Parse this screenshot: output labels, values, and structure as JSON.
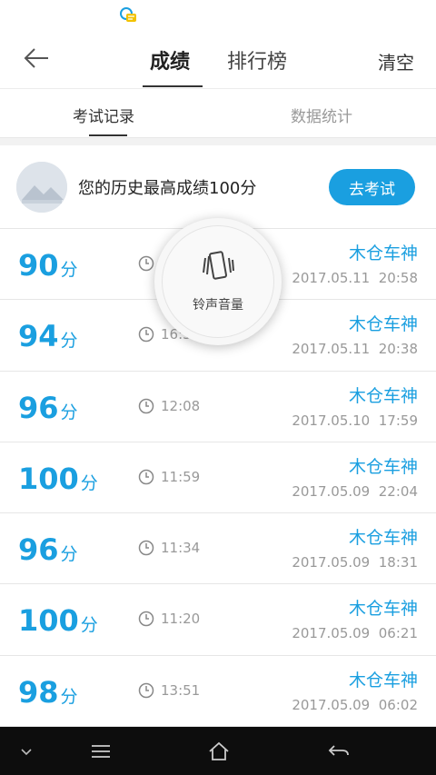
{
  "status_bar": {
    "icon": "chat-notification-icon"
  },
  "header": {
    "back_icon": "arrow-left-icon",
    "tabs": [
      {
        "label": "成绩",
        "active": true
      },
      {
        "label": "排行榜",
        "active": false
      }
    ],
    "clear_label": "清空"
  },
  "subtabs": [
    {
      "label": "考试记录",
      "active": true
    },
    {
      "label": "数据统计",
      "active": false
    }
  ],
  "best": {
    "text": "您的历史最高成绩100分",
    "button_label": "去考试"
  },
  "records": [
    {
      "score": "90",
      "unit": "分",
      "duration": "",
      "name": "木仓车神",
      "datetime": "2017.05.11  20:58"
    },
    {
      "score": "94",
      "unit": "分",
      "duration": "16:5",
      "name": "木仓车神",
      "datetime": "2017.05.11  20:38"
    },
    {
      "score": "96",
      "unit": "分",
      "duration": "12:08",
      "name": "木仓车神",
      "datetime": "2017.05.10  17:59"
    },
    {
      "score": "100",
      "unit": "分",
      "duration": "11:59",
      "name": "木仓车神",
      "datetime": "2017.05.09  22:04"
    },
    {
      "score": "96",
      "unit": "分",
      "duration": "11:34",
      "name": "木仓车神",
      "datetime": "2017.05.09  18:31"
    },
    {
      "score": "100",
      "unit": "分",
      "duration": "11:20",
      "name": "木仓车神",
      "datetime": "2017.05.09  06:21"
    },
    {
      "score": "98",
      "unit": "分",
      "duration": "13:51",
      "name": "木仓车神",
      "datetime": "2017.05.09  06:02"
    }
  ],
  "toast": {
    "label": "铃声音量",
    "icon": "phone-vibrate-icon"
  },
  "navbar": {
    "icons": [
      "chevron-down-icon",
      "menu-icon",
      "home-icon",
      "back-icon"
    ]
  },
  "colors": {
    "accent": "#1a9fe0",
    "text_gray": "#999999",
    "nav_bg": "#0d0d0d"
  }
}
